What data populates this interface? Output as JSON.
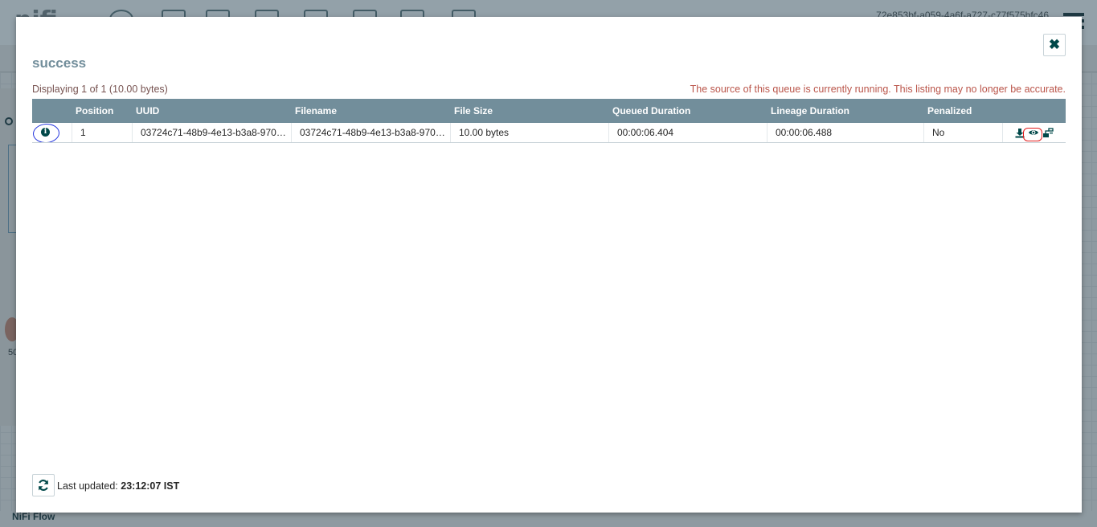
{
  "background": {
    "logo_text": "nifi",
    "uuid": "72e853bf-a059-4a6f-a727-c77f575bfc46",
    "footer_breadcrumb": "NiFi Flow",
    "panel_label": "50"
  },
  "dialog": {
    "title": "success",
    "summary": "Displaying 1 of 1 (10.00 bytes)",
    "warning": "The source of this queue is currently running. This listing may no longer be accurate.",
    "columns": [
      "Position",
      "UUID",
      "Filename",
      "File Size",
      "Queued Duration",
      "Lineage Duration",
      "Penalized"
    ],
    "rows": [
      {
        "position": "1",
        "uuid": "03724c71-48b9-4e13-b3a8-970b…",
        "filename": "03724c71-48b9-4e13-b3a8-970b…",
        "file_size": "10.00 bytes",
        "queued_duration": "00:00:06.404",
        "lineage_duration": "00:00:06.488",
        "penalized": "No"
      }
    ],
    "icons": {
      "info": "info-icon",
      "download": "download-icon",
      "view": "eye-icon",
      "provenance": "provenance-icon",
      "close": "close-icon",
      "refresh": "refresh-icon"
    },
    "footer": {
      "last_updated_label": "Last updated:",
      "last_updated_time": "23:12:07 IST"
    }
  },
  "colors": {
    "header_bg": "#728e9b",
    "title": "#728e9b",
    "warning": "#ba554a",
    "summary": "#775351",
    "icon": "#004849",
    "annotation_blue": "#2233dd",
    "annotation_red": "#e21c1c"
  }
}
